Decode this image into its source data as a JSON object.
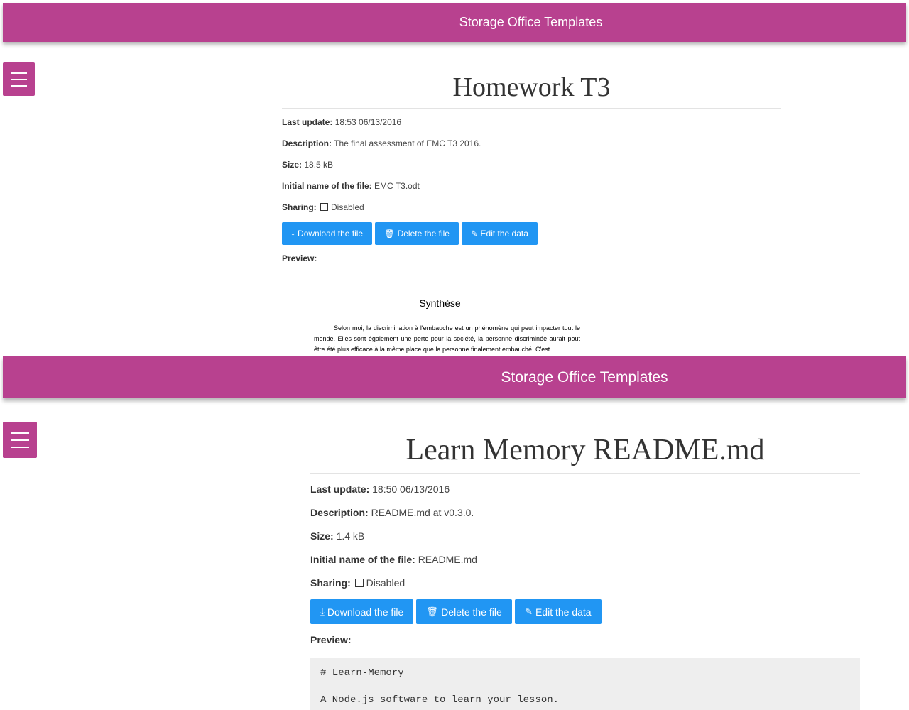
{
  "screens": [
    {
      "navbar": {
        "title": "Storage Office Templates"
      },
      "document": {
        "title": "Homework T3",
        "fields": {
          "last_update": {
            "label": "Last update:",
            "value": "18:53 06/13/2016"
          },
          "description": {
            "label": "Description:",
            "value": "The final assessment of EMC T3 2016."
          },
          "size": {
            "label": "Size:",
            "value": "18.5 kB"
          },
          "initial_name": {
            "label": "Initial name of the file:",
            "value": "EMC T3.odt"
          },
          "sharing": {
            "label": "Sharing:",
            "value": "Disabled",
            "checked": false
          }
        },
        "buttons": {
          "download": {
            "icon": "download-icon",
            "label": "Download the file"
          },
          "delete": {
            "icon": "trash-icon",
            "label": "Delete the file"
          },
          "edit": {
            "icon": "pencil-icon",
            "label": "Edit the data"
          }
        },
        "preview": {
          "label": "Preview:",
          "heading": "Synthèse",
          "text": "Selon moi, la discrimination à l'embauche est un phénomène qui peut impacter tout le monde. Elles sont également une perte pour la société, la personne discriminée aurait pout être été plus efficace à la même place que la personne finalement embauché. C'est"
        }
      }
    },
    {
      "navbar": {
        "title": "Storage Office Templates"
      },
      "document": {
        "title": "Learn Memory README.md",
        "fields": {
          "last_update": {
            "label": "Last update:",
            "value": "18:50 06/13/2016"
          },
          "description": {
            "label": "Description:",
            "value": "README.md at v0.3.0."
          },
          "size": {
            "label": "Size:",
            "value": "1.4 kB"
          },
          "initial_name": {
            "label": "Initial name of the file:",
            "value": "README.md"
          },
          "sharing": {
            "label": "Sharing:",
            "value": "Disabled",
            "checked": false
          }
        },
        "buttons": {
          "download": {
            "icon": "download-icon",
            "label": "Download the file"
          },
          "delete": {
            "icon": "trash-icon",
            "label": "Delete the file"
          },
          "edit": {
            "icon": "pencil-icon",
            "label": "Edit the data"
          }
        },
        "preview": {
          "label": "Preview:",
          "code": "# Learn-Memory\n\nA Node.js software to learn your lesson."
        }
      }
    }
  ],
  "colors": {
    "navbar": "#b8418f",
    "button": "#2196f3"
  }
}
